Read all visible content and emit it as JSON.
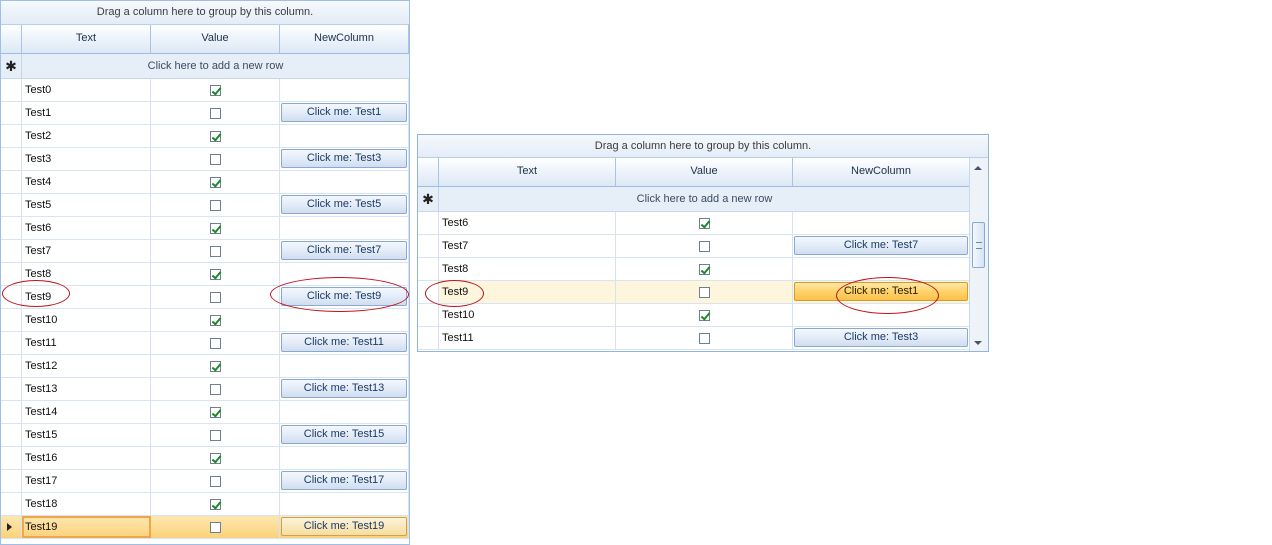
{
  "left_grid": {
    "group_panel": "Drag a column here to group by this column.",
    "columns": [
      "Text",
      "Value",
      "NewColumn"
    ],
    "new_row_text": "Click here to add a new row",
    "rows": [
      {
        "text": "Test0",
        "checked": true,
        "button": null
      },
      {
        "text": "Test1",
        "checked": false,
        "button": "Click me: Test1"
      },
      {
        "text": "Test2",
        "checked": true,
        "button": null
      },
      {
        "text": "Test3",
        "checked": false,
        "button": "Click me: Test3"
      },
      {
        "text": "Test4",
        "checked": true,
        "button": null
      },
      {
        "text": "Test5",
        "checked": false,
        "button": "Click me: Test5"
      },
      {
        "text": "Test6",
        "checked": true,
        "button": null
      },
      {
        "text": "Test7",
        "checked": false,
        "button": "Click me: Test7"
      },
      {
        "text": "Test8",
        "checked": true,
        "button": null
      },
      {
        "text": "Test9",
        "checked": false,
        "button": "Click me: Test9"
      },
      {
        "text": "Test10",
        "checked": true,
        "button": null
      },
      {
        "text": "Test11",
        "checked": false,
        "button": "Click me: Test11"
      },
      {
        "text": "Test12",
        "checked": true,
        "button": null
      },
      {
        "text": "Test13",
        "checked": false,
        "button": "Click me: Test13"
      },
      {
        "text": "Test14",
        "checked": true,
        "button": null
      },
      {
        "text": "Test15",
        "checked": false,
        "button": "Click me: Test15"
      },
      {
        "text": "Test16",
        "checked": true,
        "button": null
      },
      {
        "text": "Test17",
        "checked": false,
        "button": "Click me: Test17"
      },
      {
        "text": "Test18",
        "checked": true,
        "button": null
      },
      {
        "text": "Test19",
        "checked": false,
        "button": "Click me: Test19"
      }
    ],
    "current_row": "Test19"
  },
  "right_grid": {
    "group_panel": "Drag a column here to group by this column.",
    "columns": [
      "Text",
      "Value",
      "NewColumn"
    ],
    "new_row_text": "Click here to add a new row",
    "rows": [
      {
        "text": "Test6",
        "checked": true,
        "button": null
      },
      {
        "text": "Test7",
        "checked": false,
        "button": "Click me: Test7"
      },
      {
        "text": "Test8",
        "checked": true,
        "button": null
      },
      {
        "text": "Test9",
        "checked": false,
        "button": "Click me: Test1"
      },
      {
        "text": "Test10",
        "checked": true,
        "button": null
      },
      {
        "text": "Test11",
        "checked": false,
        "button": "Click me: Test3"
      }
    ],
    "highlighted_row": "Test9"
  },
  "new_row_glyph": "✱",
  "colors": {
    "accent": "#fbd27a",
    "annotation": "#c0121b",
    "border": "#9fc0e4"
  }
}
